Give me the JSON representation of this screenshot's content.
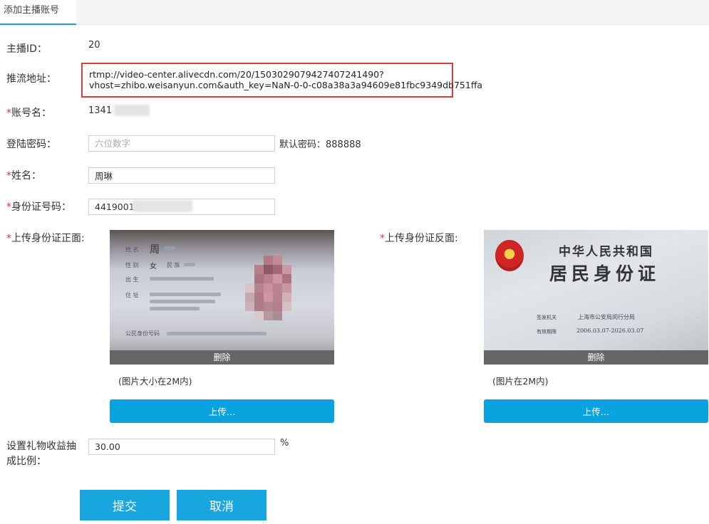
{
  "tab": {
    "label": "添加主播账号"
  },
  "form": {
    "anchor_id": {
      "label": "主播ID：",
      "value": "20"
    },
    "stream_url": {
      "label": "推流地址：",
      "line1": "rtmp://video-center.alivecdn.com/20/150302907942740724149​0?",
      "line2": "vhost=zhibo.weisanyun.com&auth_key=NaN-0-0-c08a38a3a94609e81fbc9349db751ffa"
    },
    "account": {
      "required": "*",
      "label": "账号名：",
      "value": "1341"
    },
    "password": {
      "label": "登陆密码：",
      "placeholder": "六位数字",
      "default_hint": "默认密码：888888"
    },
    "name": {
      "required": "*",
      "label": "姓名：",
      "value": "周琳"
    },
    "id_number": {
      "required": "*",
      "label": "身份证号码：",
      "value": "44190015"
    },
    "id_front": {
      "required": "*",
      "label": "上传身份证正面:",
      "delete_label": "删除",
      "hint": "(图片大小在2M内)",
      "upload_label": "上传…"
    },
    "id_back": {
      "required": "*",
      "label": "上传身份证反面:",
      "delete_label": "删除",
      "hint": "(图片在2M内)",
      "upload_label": "上传…"
    },
    "gift_ratio": {
      "label_line1": "设置礼物收益抽",
      "label_line2": "成比例：",
      "value": "30.00",
      "unit": "%"
    }
  },
  "id_card_front": {
    "name_label": "姓 名",
    "name_value": "周",
    "sex_label": "性 别",
    "sex_value": "女",
    "nation_label": "民 族",
    "birth_label": "出 生",
    "address_label": "住 址",
    "number_label": "公民身份号码"
  },
  "id_card_back": {
    "country": "中华人民共和国",
    "title": "居民身份证",
    "authority_label": "签发机关",
    "authority_value": "上海市公安局闵行分局",
    "validity_label": "有效期限",
    "validity_value": "2006.03.07-2026.03.07"
  },
  "actions": {
    "submit": "提交",
    "cancel": "取消"
  },
  "colors": {
    "accent": "#19a6de",
    "highlight_border": "#e03a3a",
    "required": "#e4393c"
  }
}
